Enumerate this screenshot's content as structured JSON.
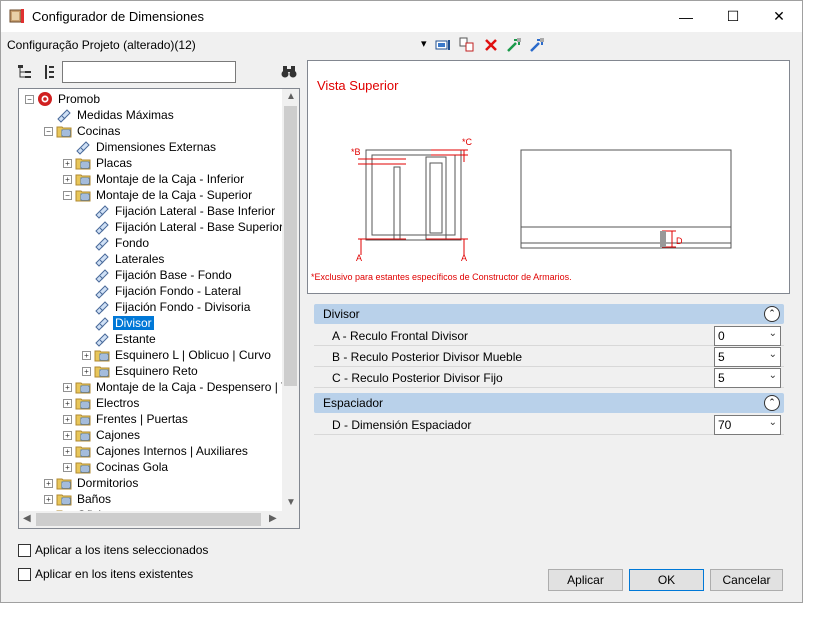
{
  "window": {
    "title": "Configurador de Dimensiones",
    "minimize": "—",
    "maximize": "☐",
    "close": "✕"
  },
  "toolbar": {
    "config_label": "Configuração Projeto (alterado)(12)",
    "dropdown_arrow": "▾"
  },
  "tree": {
    "items": [
      {
        "label": "Promob",
        "level": 0,
        "exp": "−",
        "icon": "promob-logo-icon"
      },
      {
        "label": "Medidas Máximas",
        "level": 1,
        "exp": "",
        "icon": "tag-icon"
      },
      {
        "label": "Cocinas",
        "level": 1,
        "exp": "−",
        "icon": "folder-icon"
      },
      {
        "label": "Dimensiones Externas",
        "level": 2,
        "exp": "",
        "icon": "tag-icon"
      },
      {
        "label": "Placas",
        "level": 2,
        "exp": "+",
        "icon": "folder-icon"
      },
      {
        "label": "Montaje de la Caja - Inferior",
        "level": 2,
        "exp": "+",
        "icon": "folder-icon"
      },
      {
        "label": "Montaje de la Caja - Superior",
        "level": 2,
        "exp": "−",
        "icon": "folder-icon"
      },
      {
        "label": "Fijación Lateral - Base Inferior",
        "level": 3,
        "exp": "",
        "icon": "tag-icon"
      },
      {
        "label": "Fijación Lateral - Base Superior",
        "level": 3,
        "exp": "",
        "icon": "tag-icon"
      },
      {
        "label": "Fondo",
        "level": 3,
        "exp": "",
        "icon": "tag-icon"
      },
      {
        "label": "Laterales",
        "level": 3,
        "exp": "",
        "icon": "tag-icon"
      },
      {
        "label": " Fijación Base - Fondo",
        "level": 3,
        "exp": "",
        "icon": "tag-icon"
      },
      {
        "label": "Fijación Fondo - Lateral",
        "level": 3,
        "exp": "",
        "icon": "tag-icon"
      },
      {
        "label": "Fijación Fondo - Divisoria",
        "level": 3,
        "exp": "",
        "icon": "tag-icon"
      },
      {
        "label": "Divisor",
        "level": 3,
        "exp": "",
        "icon": "tag-icon",
        "selected": true
      },
      {
        "label": "Estante",
        "level": 3,
        "exp": "",
        "icon": "tag-icon"
      },
      {
        "label": "Esquinero L | Oblicuo | Curvo",
        "level": 3,
        "exp": "+",
        "icon": "folder-icon"
      },
      {
        "label": "Esquinero Reto",
        "level": 3,
        "exp": "+",
        "icon": "folder-icon"
      },
      {
        "label": "Montaje de la Caja - Despensero | Torre",
        "level": 2,
        "exp": "+",
        "icon": "folder-icon"
      },
      {
        "label": "Electros",
        "level": 2,
        "exp": "+",
        "icon": "folder-icon"
      },
      {
        "label": "Frentes | Puertas",
        "level": 2,
        "exp": "+",
        "icon": "folder-icon"
      },
      {
        "label": "Cajones",
        "level": 2,
        "exp": "+",
        "icon": "folder-icon"
      },
      {
        "label": "Cajones Internos | Auxiliares",
        "level": 2,
        "exp": "+",
        "icon": "folder-icon"
      },
      {
        "label": "Cocinas Gola",
        "level": 2,
        "exp": "+",
        "icon": "folder-icon"
      },
      {
        "label": "Dormitorios",
        "level": 1,
        "exp": "+",
        "icon": "folder-icon"
      },
      {
        "label": "Baños",
        "level": 1,
        "exp": "+",
        "icon": "folder-icon"
      },
      {
        "label": "Oficina",
        "level": 1,
        "exp": "+",
        "icon": "folder-icon"
      }
    ]
  },
  "preview": {
    "title": "Vista Superior",
    "note": "*Exclusivo para estantes específicos de Constructor de Armarios.",
    "labels": {
      "a": "A",
      "b": "*B",
      "c": "*C",
      "d": "D"
    },
    "accent": "#e00000"
  },
  "groups": [
    {
      "title": "Divisor",
      "toggle": "⌃",
      "props": [
        {
          "name": "A - Reculo Frontal Divisor",
          "value": "0"
        },
        {
          "name": "B - Reculo Posterior Divisor Mueble",
          "value": "5"
        },
        {
          "name": "C - Reculo Posterior Divisor Fijo",
          "value": "5"
        }
      ]
    },
    {
      "title": "Espaciador",
      "toggle": "⌃",
      "props": [
        {
          "name": "D - Dimensión Espaciador",
          "value": "70"
        }
      ]
    }
  ],
  "options": {
    "apply_selected": "Aplicar a los itens seleccionados",
    "apply_existing": "Aplicar en los itens existentes"
  },
  "buttons": {
    "apply": "Aplicar",
    "ok": "OK",
    "cancel": "Cancelar"
  },
  "chevron": "⌄",
  "colors": {
    "group_header": "#b9d1ea",
    "selection": "#0078d7",
    "folder": "#e8c65a"
  }
}
